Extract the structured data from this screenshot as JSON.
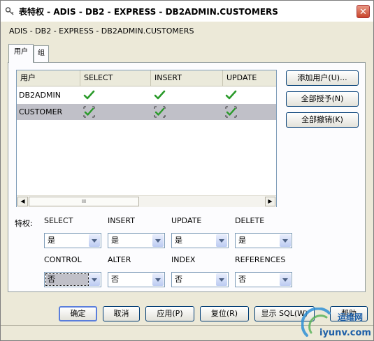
{
  "window": {
    "title": "表特权 - ADIS - DB2 - EXPRESS - DB2ADMIN.CUSTOMERS",
    "close_label": "✕"
  },
  "subtitle": "ADIS - DB2 - EXPRESS - DB2ADMIN.CUSTOMERS",
  "tabs": [
    {
      "label": "用户",
      "active": true
    },
    {
      "label": "组",
      "active": false
    }
  ],
  "table": {
    "columns": [
      "用户",
      "SELECT",
      "INSERT",
      "UPDATE"
    ],
    "rows": [
      {
        "name": "DB2ADMIN",
        "select": "granted",
        "insert": "granted",
        "update": "granted",
        "selected": false
      },
      {
        "name": "CUSTOMER",
        "select": "granted",
        "insert": "granted",
        "update": "granted",
        "selected": true
      }
    ],
    "scrollbar_grip": "III",
    "scroll_left": "◀",
    "scroll_right": "▶"
  },
  "side_buttons": {
    "add_user": "添加用户(U)...",
    "grant_all": "全部授予(N)",
    "revoke_all": "全部撤销(K)"
  },
  "privileges": {
    "label": "特权:",
    "fields": [
      {
        "name": "SELECT",
        "value": "是"
      },
      {
        "name": "INSERT",
        "value": "是"
      },
      {
        "name": "UPDATE",
        "value": "是"
      },
      {
        "name": "DELETE",
        "value": "是"
      },
      {
        "name": "CONTROL",
        "value": "否"
      },
      {
        "name": "ALTER",
        "value": "否"
      },
      {
        "name": "INDEX",
        "value": "否"
      },
      {
        "name": "REFERENCES",
        "value": "否"
      }
    ]
  },
  "footer": {
    "ok": "确定",
    "cancel": "取消",
    "apply": "应用(P)",
    "reset": "复位(R)",
    "show_sql": "显示 SQL(W)",
    "help": "帮助"
  },
  "watermark": {
    "text1": "运维网",
    "text2": "iyunv.com"
  },
  "colors": {
    "check": "#2a9a2a",
    "selected_row": "#c0c0c8",
    "accent": "#5a7edc"
  }
}
